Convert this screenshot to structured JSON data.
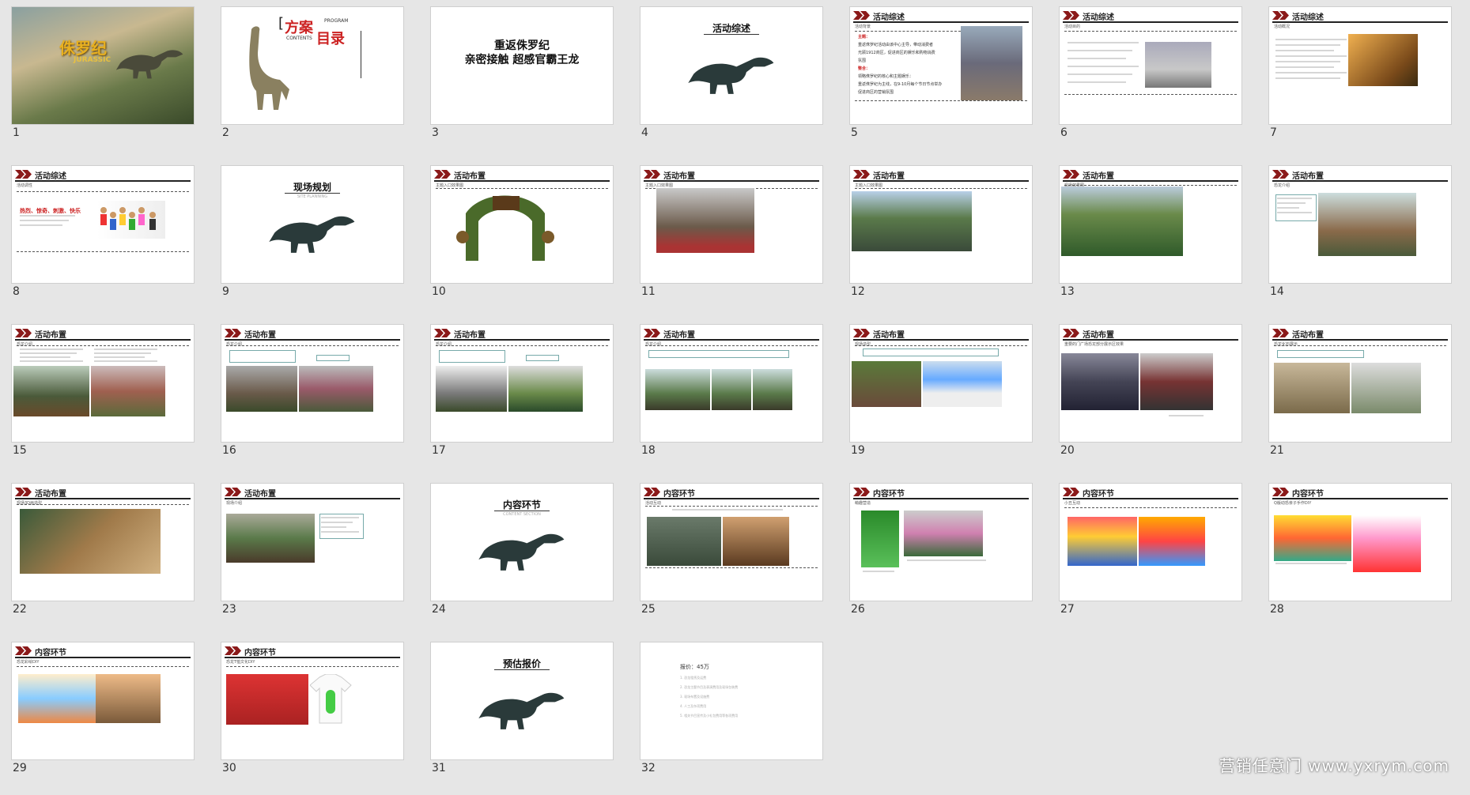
{
  "slides": [
    {
      "n": "1",
      "kind": "cover",
      "title": "侏罗纪",
      "subtitle": "JURASSIC"
    },
    {
      "n": "2",
      "kind": "toc",
      "t1": "方案",
      "t2": "目录",
      "en1": "PROGRAM",
      "en2": "CONTENTS"
    },
    {
      "n": "3",
      "kind": "text",
      "line1": "重返侏罗纪",
      "line2": "亲密接触  超感官霸王龙"
    },
    {
      "n": "4",
      "kind": "section",
      "title": "活动综述",
      "en": ""
    },
    {
      "n": "5",
      "kind": "content",
      "header": "活动综述",
      "sub": "活动背景",
      "body": [
        "主题：",
        "重返侏罗纪活动由该中心主导，带动消费者",
        "光顾1912商区，促进商区的娱乐和购物消费",
        "氛围",
        "整合：",
        "领略侏罗纪的核心和主题娱乐：",
        "重返侏罗纪为主线，在9-10月每个节日节点举办",
        "促进商区的营销氛围"
      ]
    },
    {
      "n": "6",
      "kind": "content",
      "header": "活动综述",
      "sub": "活动目的"
    },
    {
      "n": "7",
      "kind": "content",
      "header": "活动综述",
      "sub": "活动概况"
    },
    {
      "n": "8",
      "kind": "content",
      "header": "活动综述",
      "sub": "活动调性",
      "body": [
        "热烈、惊奇、刺激、快乐"
      ]
    },
    {
      "n": "9",
      "kind": "section",
      "title": "现场规划",
      "en": "SITE PLANNING"
    },
    {
      "n": "10",
      "kind": "content",
      "header": "活动布置",
      "sub": "主题入口效果图"
    },
    {
      "n": "11",
      "kind": "content",
      "header": "活动布置",
      "sub": "主题入口效果图"
    },
    {
      "n": "12",
      "kind": "content",
      "header": "活动布置",
      "sub": "主题入口效果图"
    },
    {
      "n": "13",
      "kind": "content",
      "header": "活动布置",
      "sub": "现场效果图"
    },
    {
      "n": "14",
      "kind": "content",
      "header": "活动布置",
      "sub": "恐龙介绍"
    },
    {
      "n": "15",
      "kind": "content",
      "header": "活动布置",
      "sub": "恐龙介绍"
    },
    {
      "n": "16",
      "kind": "content",
      "header": "活动布置",
      "sub": "恐龙介绍"
    },
    {
      "n": "17",
      "kind": "content",
      "header": "活动布置",
      "sub": "恐龙介绍"
    },
    {
      "n": "18",
      "kind": "content",
      "header": "活动布置",
      "sub": "恐龙介绍"
    },
    {
      "n": "19",
      "kind": "content",
      "header": "活动布置",
      "sub": "现场造型"
    },
    {
      "n": "20",
      "kind": "content",
      "header": "活动布置",
      "sub": "重要的门广场恐龙部分展示区效果"
    },
    {
      "n": "21",
      "kind": "content",
      "header": "活动布置",
      "sub": "恐龙化石展示"
    },
    {
      "n": "22",
      "kind": "content",
      "header": "活动布置",
      "sub": "现场3D画造型"
    },
    {
      "n": "23",
      "kind": "content",
      "header": "活动布置",
      "sub": "现场介绍"
    },
    {
      "n": "24",
      "kind": "section",
      "title": "内容环节",
      "en": "CONTENT SECTION"
    },
    {
      "n": "25",
      "kind": "content",
      "header": "内容环节",
      "sub": "活动互动"
    },
    {
      "n": "26",
      "kind": "content",
      "header": "内容环节",
      "sub": "萌趣营造"
    },
    {
      "n": "27",
      "kind": "content",
      "header": "内容环节",
      "sub": "小丑互动"
    },
    {
      "n": "28",
      "kind": "content",
      "header": "内容环节",
      "sub": "Q版动恐亲子手作DIY"
    },
    {
      "n": "29",
      "kind": "content",
      "header": "内容环节",
      "sub": "恐龙彩绘DIY"
    },
    {
      "n": "30",
      "kind": "content",
      "header": "内容环节",
      "sub": "恐龙T恤文化DIY"
    },
    {
      "n": "31",
      "kind": "section",
      "title": "预估报价",
      "en": ""
    },
    {
      "n": "32",
      "kind": "price",
      "title": "报价：45万",
      "items": [
        "1. 恐龙租赁及运费",
        "2. 恐龙主题节目及表演费用及现场包装费",
        "3. 现场布置及设施费",
        "4. 人工及杂项费用",
        "5. 相关节目宣传及小礼包费用等各项费用"
      ]
    }
  ],
  "watermark": "营销任意门 www.yxrym.com"
}
